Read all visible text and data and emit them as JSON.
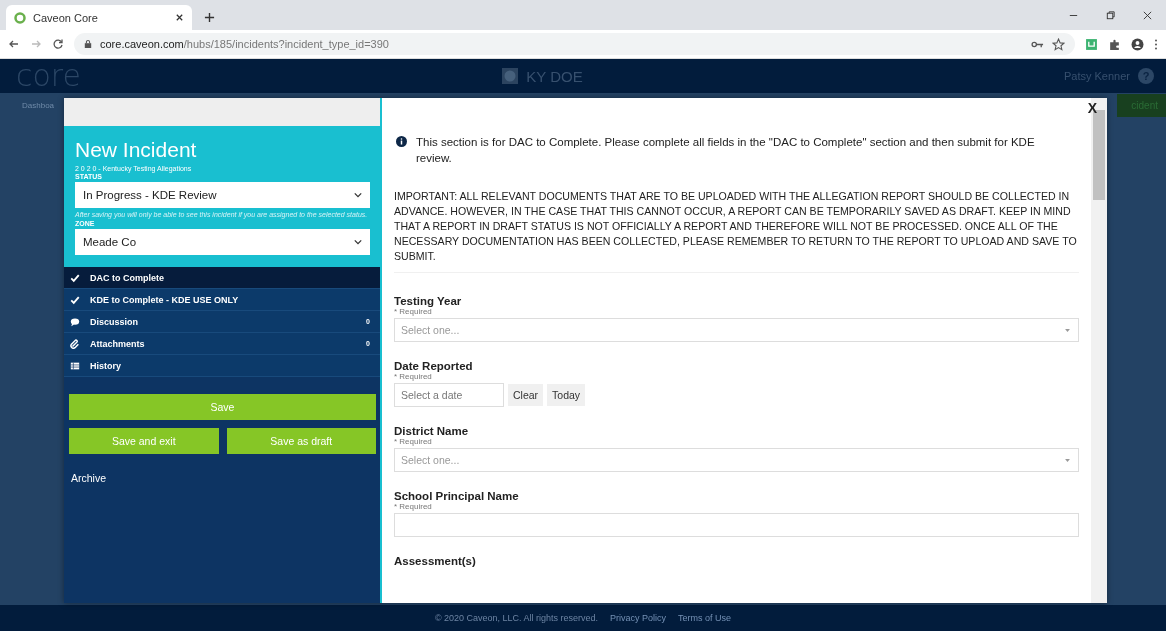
{
  "browser": {
    "tab_title": "Caveon Core",
    "url_host": "core.caveon.com",
    "url_path": "/hubs/185/incidents?incident_type_id=390"
  },
  "header": {
    "logo": "core",
    "title": "KY DOE",
    "user": "Patsy Kenner",
    "help": "?"
  },
  "background": {
    "nav_item": "Dashboa",
    "action_button": "cident"
  },
  "sidebar": {
    "title": "New Incident",
    "subtitle": "2 0 2 0 - Kentucky Testing Allegations",
    "status_label": "STATUS",
    "status_value": "In Progress - KDE Review",
    "status_hint": "After saving you will only be able to see this incident if you are assigned to the selected status.",
    "zone_label": "ZONE",
    "zone_value": "Meade Co",
    "items": [
      {
        "kind": "check",
        "label": "DAC to Complete",
        "selected": true
      },
      {
        "kind": "check",
        "label": "KDE to Complete - KDE USE ONLY",
        "selected": false
      },
      {
        "kind": "discussion",
        "label": "Discussion",
        "count": "0",
        "selected": false
      },
      {
        "kind": "attachments",
        "label": "Attachments",
        "count": "0",
        "selected": false
      },
      {
        "kind": "history",
        "label": "History",
        "selected": false
      }
    ],
    "save": "Save",
    "save_exit": "Save and exit",
    "save_draft": "Save as draft",
    "archive": "Archive"
  },
  "form": {
    "close": "X",
    "info": "This section is for DAC to Complete. Please complete all fields in the \"DAC to Complete\" section and then submit for KDE review.",
    "important": "IMPORTANT: ALL RELEVANT DOCUMENTS THAT ARE TO BE UPLOADED WITH THE ALLEGATION REPORT SHOULD BE COLLECTED IN ADVANCE. HOWEVER, IN THE CASE THAT THIS CANNOT OCCUR, A REPORT CAN BE TEMPORARILY SAVED AS DRAFT. KEEP IN MIND THAT A REPORT IN DRAFT STATUS IS NOT OFFICIALLY A REPORT AND THEREFORE WILL NOT BE PROCESSED. ONCE ALL OF THE NECESSARY DOCUMENTATION HAS BEEN COLLECTED, PLEASE REMEMBER TO RETURN TO THE REPORT TO UPLOAD AND SAVE TO SUBMIT.",
    "fields": [
      {
        "kind": "select",
        "label": "Testing Year",
        "required": "* Required",
        "placeholder": "Select one..."
      },
      {
        "kind": "date",
        "label": "Date Reported",
        "required": "* Required",
        "placeholder": "Select a date",
        "clear": "Clear",
        "today": "Today"
      },
      {
        "kind": "select",
        "label": "District Name",
        "required": "* Required",
        "placeholder": "Select one..."
      },
      {
        "kind": "text",
        "label": "School Principal Name",
        "required": "* Required"
      },
      {
        "kind": "heading",
        "label": "Assessment(s)"
      }
    ]
  },
  "footer": {
    "copyright": "© 2020 Caveon, LLC. All rights reserved.",
    "privacy": "Privacy Policy",
    "terms": "Terms of Use"
  }
}
